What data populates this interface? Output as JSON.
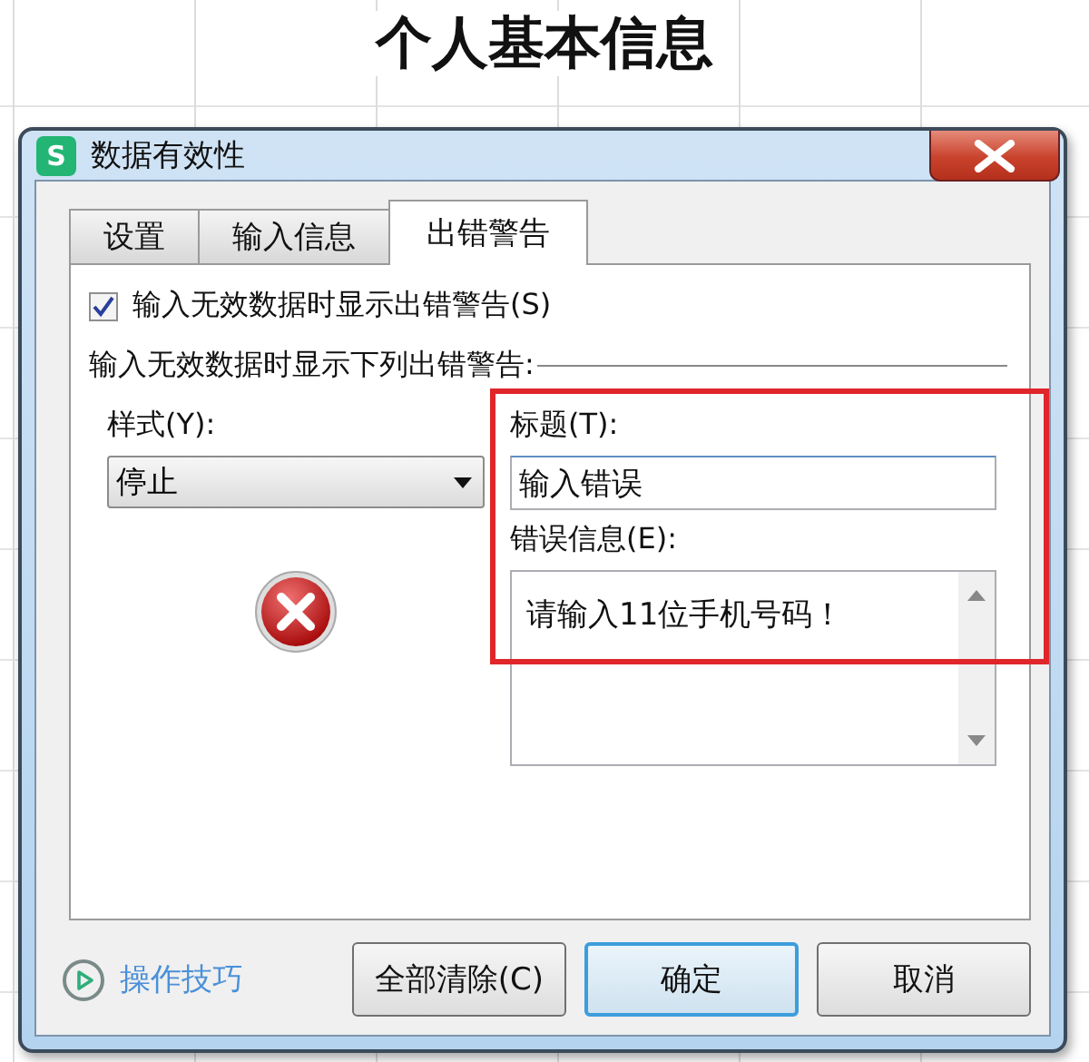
{
  "sheet": {
    "title": "个人基本信息"
  },
  "dialog": {
    "app_icon": "S",
    "title": "数据有效性",
    "tabs": [
      {
        "label": "设置",
        "selected": false
      },
      {
        "label": "输入信息",
        "selected": false
      },
      {
        "label": "出错警告",
        "selected": true
      }
    ],
    "show_alert": {
      "label": "输入无效数据时显示出错警告(S)",
      "checked": true
    },
    "group_label": "输入无效数据时显示下列出错警告:",
    "style": {
      "label": "样式(Y):",
      "value": "停止"
    },
    "title_field": {
      "label": "标题(T):",
      "value": "输入错误"
    },
    "message_field": {
      "label": "错误信息(E):",
      "value": "请输入11位手机号码！"
    },
    "tips_link": "操作技巧",
    "buttons": [
      {
        "label": "全部清除(C)",
        "focused": false
      },
      {
        "label": "确定",
        "focused": true
      },
      {
        "label": "取消",
        "focused": false
      }
    ]
  }
}
